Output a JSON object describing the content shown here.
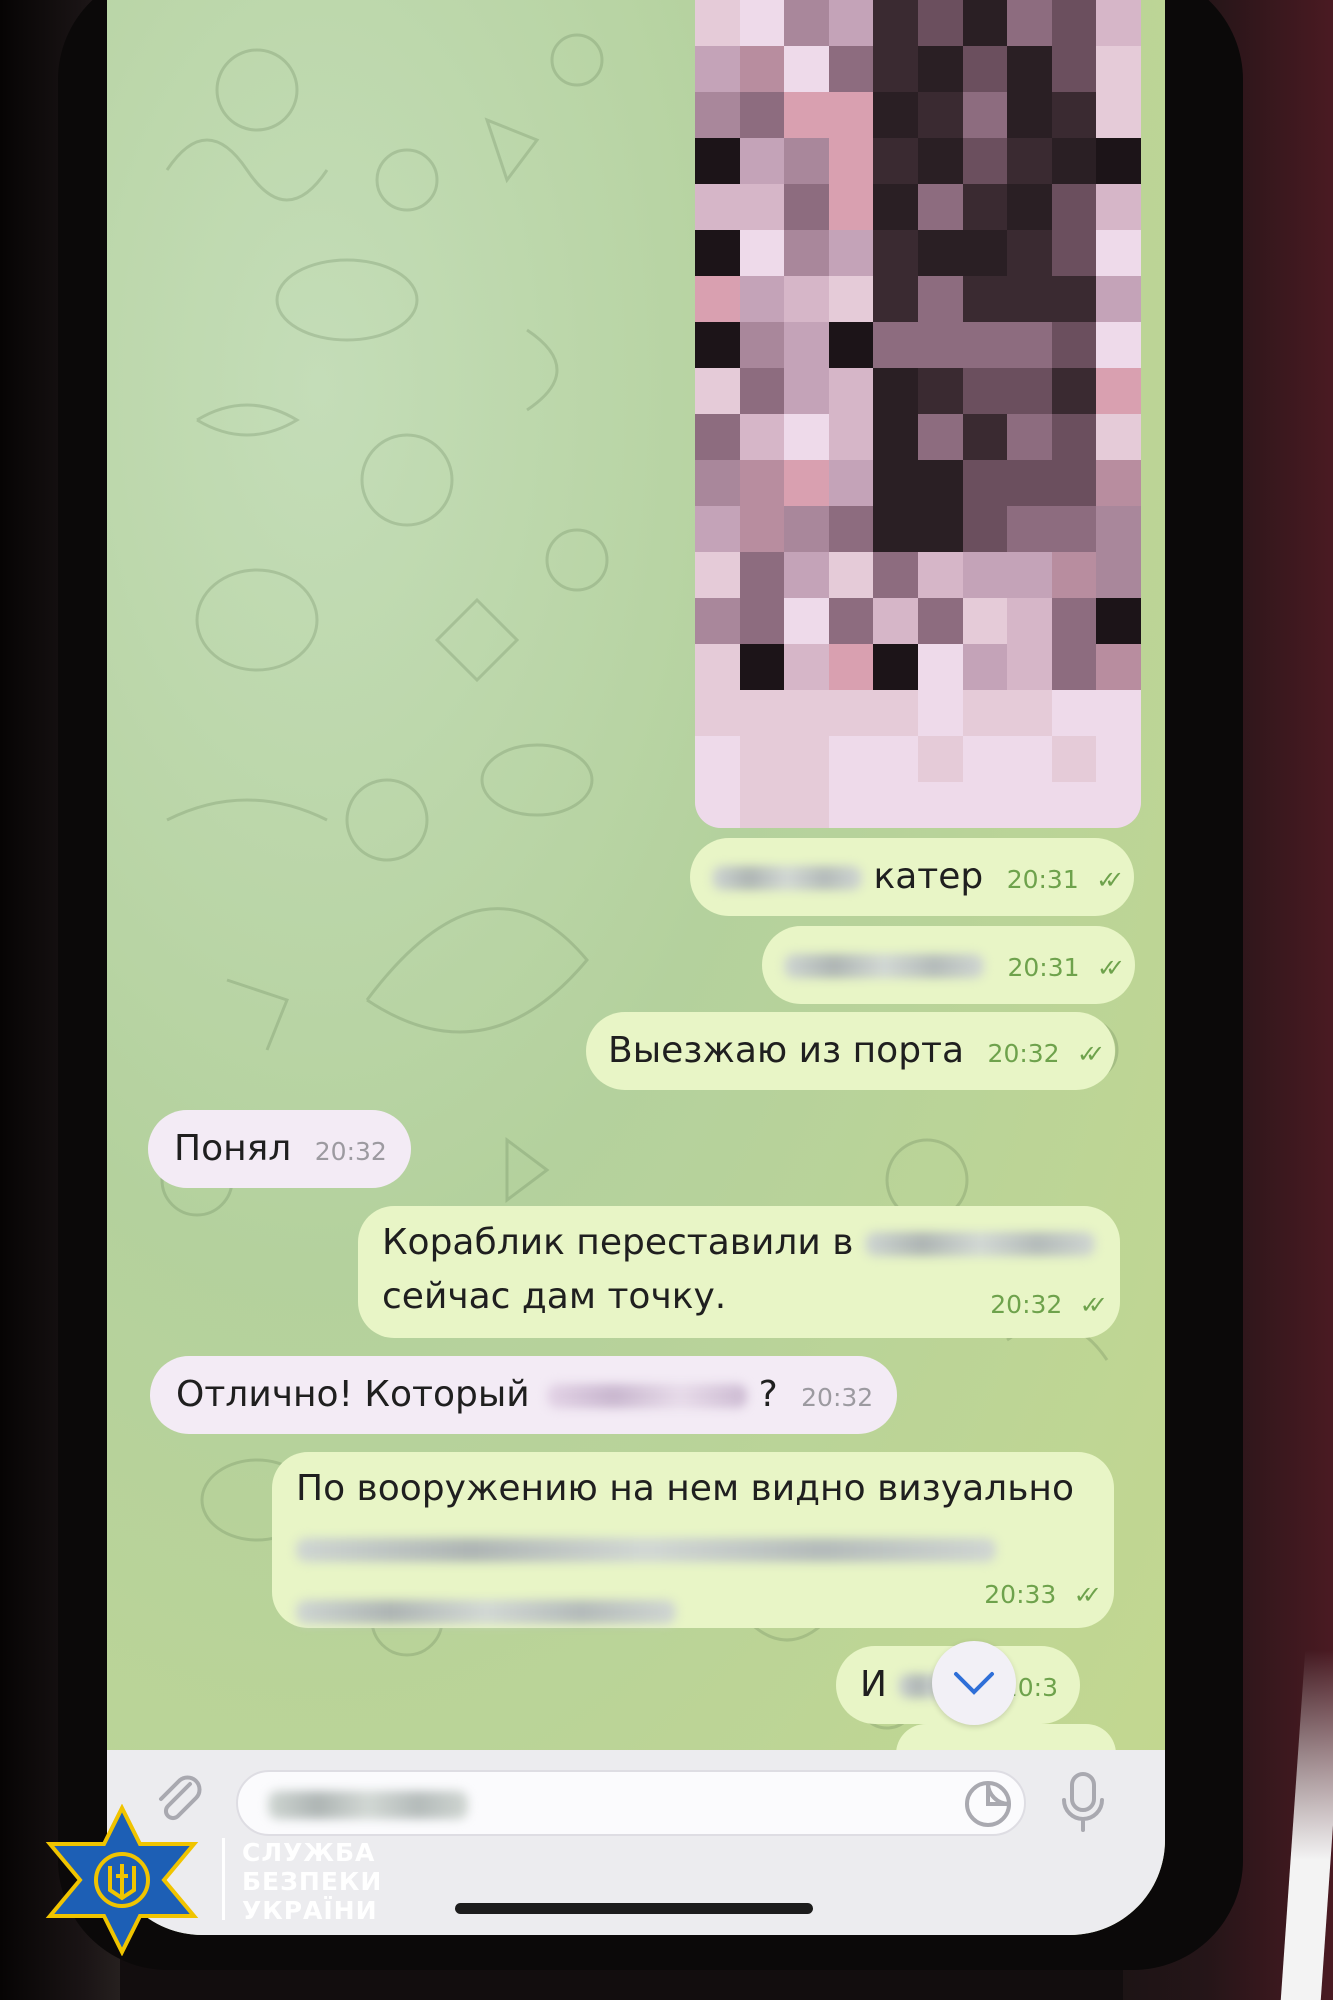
{
  "chat": {
    "messages": [
      {
        "direction": "outgoing",
        "text": "катер",
        "time": "20:31",
        "status": "read",
        "partially_blurred": true
      },
      {
        "direction": "outgoing",
        "text": "",
        "time": "20:31",
        "status": "read",
        "partially_blurred": true
      },
      {
        "direction": "outgoing",
        "text": "Выезжаю из порта",
        "time": "20:32",
        "status": "read"
      },
      {
        "direction": "incoming",
        "text": "Понял",
        "time": "20:32"
      },
      {
        "direction": "outgoing",
        "lines": [
          "Кораблик переставили в",
          "сейчас дам точку."
        ],
        "time": "20:32",
        "status": "read",
        "partially_blurred": true
      },
      {
        "direction": "incoming",
        "text": "Отлично! Который",
        "text_after": "?",
        "time": "20:32",
        "partially_blurred": true
      },
      {
        "direction": "outgoing",
        "text": "По вооружению на нем видно визуально",
        "time": "20:33",
        "status": "read",
        "partially_blurred": true
      },
      {
        "direction": "outgoing",
        "text": "И",
        "time": "20:3",
        "status": "read",
        "partially_blurred": true
      }
    ],
    "read_mark": "✓✓"
  },
  "input_bar": {
    "attach_icon": "paperclip-icon",
    "sticker_icon": "sticker-icon",
    "mic_icon": "microphone-icon"
  },
  "scroll_down_icon": "chevron-down-icon",
  "watermark": {
    "line1": "СЛУЖБА",
    "line2": "БЕЗПЕКИ",
    "line3": "УКРАЇНИ",
    "colors": {
      "shield_blue": "#1d5fb5",
      "trident_gold": "#f0c400"
    }
  },
  "colors": {
    "outgoing_bubble": "#e8f5c6",
    "incoming_bubble": "#f3ebf5",
    "time_outgoing": "#6ea24c",
    "time_incoming": "#9c9aa0"
  }
}
